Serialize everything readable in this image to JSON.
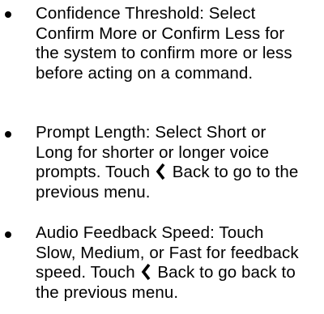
{
  "bullets": [
    {
      "text": "Confidence Threshold: Select Confirm More or Confirm Less for the system to confirm more or less before acting on a command."
    },
    {
      "text_before_icon": "Prompt Length: Select Short or Long for shorter or longer voice prompts. Touch",
      "icon": "chevron-left-icon",
      "text_after_icon": "Back to go to the previous menu."
    },
    {
      "text_before_icon": "Audio Feedback Speed: Touch Slow, Medium, or Fast for feedback speed. Touch",
      "icon": "chevron-left-icon",
      "text_after_icon": "Back to go back to the previous menu."
    }
  ]
}
